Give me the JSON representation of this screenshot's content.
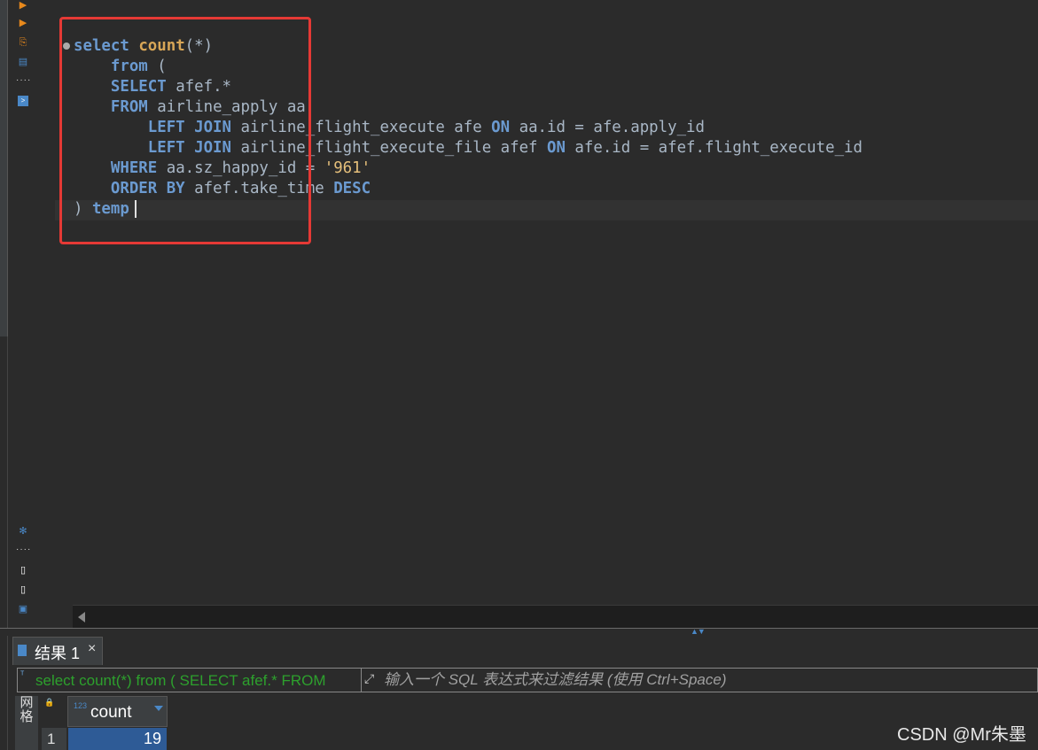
{
  "toolbar": {
    "icons": [
      "run-statement-icon",
      "run-script-icon",
      "explain-plan-icon",
      "load-script-icon",
      "terminal-icon",
      "settings-icon",
      "export-icon",
      "save-icon",
      "variables-icon"
    ],
    "accent": "#e8891c"
  },
  "editor": {
    "lines": [
      {
        "indent": "",
        "tokens": [
          [
            "kw",
            "select"
          ],
          [
            "t",
            " "
          ],
          [
            "fn",
            "count"
          ],
          [
            "t",
            "(*)"
          ]
        ]
      },
      {
        "indent": "    ",
        "tokens": [
          [
            "kw",
            "from"
          ],
          [
            "t",
            " ("
          ]
        ]
      },
      {
        "indent": "    ",
        "tokens": [
          [
            "kw",
            "SELECT"
          ],
          [
            "t",
            " afef.*"
          ]
        ]
      },
      {
        "indent": "    ",
        "tokens": [
          [
            "kw",
            "FROM"
          ],
          [
            "t",
            " airline_apply aa"
          ]
        ]
      },
      {
        "indent": "        ",
        "tokens": [
          [
            "kw",
            "LEFT JOIN"
          ],
          [
            "t",
            " airline_flight_execute afe "
          ],
          [
            "kw",
            "ON"
          ],
          [
            "t",
            " aa.id = afe.apply_id"
          ]
        ]
      },
      {
        "indent": "        ",
        "tokens": [
          [
            "kw",
            "LEFT JOIN"
          ],
          [
            "t",
            " airline_flight_execute_file afef "
          ],
          [
            "kw",
            "ON"
          ],
          [
            "t",
            " afe.id = afef.flight_execute_id"
          ]
        ]
      },
      {
        "indent": "    ",
        "tokens": [
          [
            "kw",
            "WHERE"
          ],
          [
            "t",
            " aa.sz_happy_id = "
          ],
          [
            "str",
            "'961'"
          ]
        ]
      },
      {
        "indent": "    ",
        "tokens": [
          [
            "kw",
            "ORDER BY"
          ],
          [
            "t",
            " afef.take_time "
          ],
          [
            "kw",
            "DESC"
          ]
        ]
      },
      {
        "indent": "",
        "tokens": [
          [
            "t",
            ") "
          ],
          [
            "kw",
            "temp"
          ]
        ]
      }
    ],
    "highlight_color": "#e53935"
  },
  "results": {
    "tab_label": "结果 1",
    "close_glyph": "×",
    "filter_query": "select count(*) from ( SELECT afef.* FROM",
    "filter_tag": "ᵀ",
    "filter_placeholder": "输入一个 SQL 表达式来过滤结果 (使用 Ctrl+Space)",
    "side_label": "网格",
    "column": {
      "type_badge": "123",
      "name": "count"
    },
    "rows": [
      {
        "num": "1",
        "value": "19"
      }
    ]
  },
  "watermark": "CSDN @Mr朱墨"
}
